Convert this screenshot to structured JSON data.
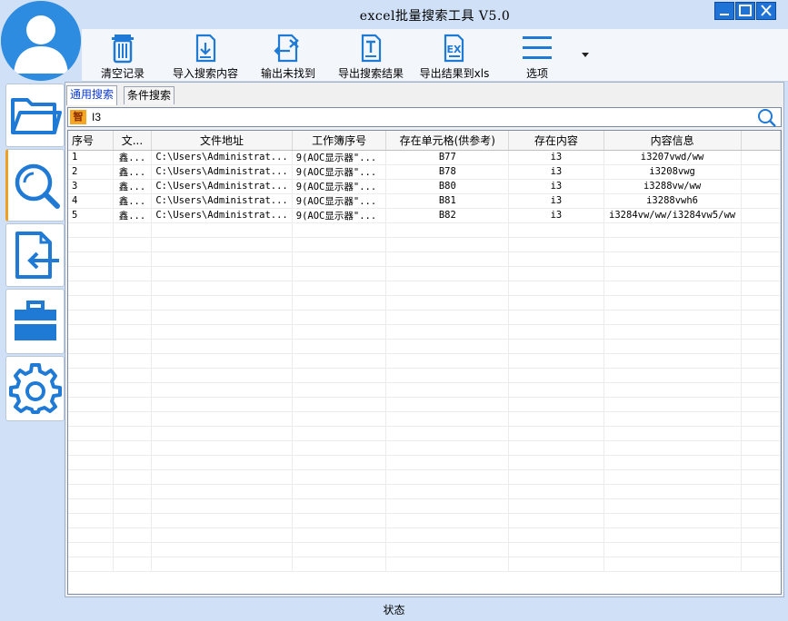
{
  "window": {
    "title": "excel批量搜索工具 V5.0"
  },
  "toolbar": {
    "clear_label": "清空记录",
    "import_label": "导入搜索内容",
    "export_missing_label": "输出未找到",
    "export_results_label": "导出搜索结果",
    "export_xls_label": "导出结果到xls",
    "options_label": "选项"
  },
  "tabs": [
    {
      "label": "通用搜索",
      "active": true
    },
    {
      "label": "条件搜索",
      "active": false
    }
  ],
  "search": {
    "tag": "智",
    "value": "I3"
  },
  "table": {
    "headers": [
      "序号",
      "文...",
      "文件地址",
      "工作簿序号",
      "存在单元格(供参考)",
      "存在内容",
      "内容信息"
    ],
    "rows": [
      [
        "1",
        "鑫...",
        "C:\\Users\\Administrat...",
        "9(AOC显示器\"...",
        "B77",
        "i3",
        "i3207vwd/ww"
      ],
      [
        "2",
        "鑫...",
        "C:\\Users\\Administrat...",
        "9(AOC显示器\"...",
        "B78",
        "i3",
        "i3208vwg"
      ],
      [
        "3",
        "鑫...",
        "C:\\Users\\Administrat...",
        "9(AOC显示器\"...",
        "B80",
        "i3",
        "i3288vw/ww"
      ],
      [
        "4",
        "鑫...",
        "C:\\Users\\Administrat...",
        "9(AOC显示器\"...",
        "B81",
        "i3",
        "i3288vwh6"
      ],
      [
        "5",
        "鑫...",
        "C:\\Users\\Administrat...",
        "9(AOC显示器\"...",
        "B82",
        "i3",
        "i3284vw/ww/i3284vw5/ww"
      ]
    ]
  },
  "status": {
    "text": "状态"
  },
  "colors": {
    "accent": "#2d8be0",
    "background": "#cfe0f7",
    "active_tab_text": "#0a3ad0",
    "selection_marker": "#f0a020"
  },
  "icons": {
    "clear": "trash-icon",
    "import": "import-file-icon",
    "export_missing": "export-missing-icon",
    "export_results": "export-text-icon",
    "export_xls": "excel-export-icon",
    "options": "hamburger-menu-icon",
    "sidebar": [
      "folder-icon",
      "search-icon",
      "file-import-icon",
      "briefcase-icon",
      "gear-icon"
    ]
  }
}
